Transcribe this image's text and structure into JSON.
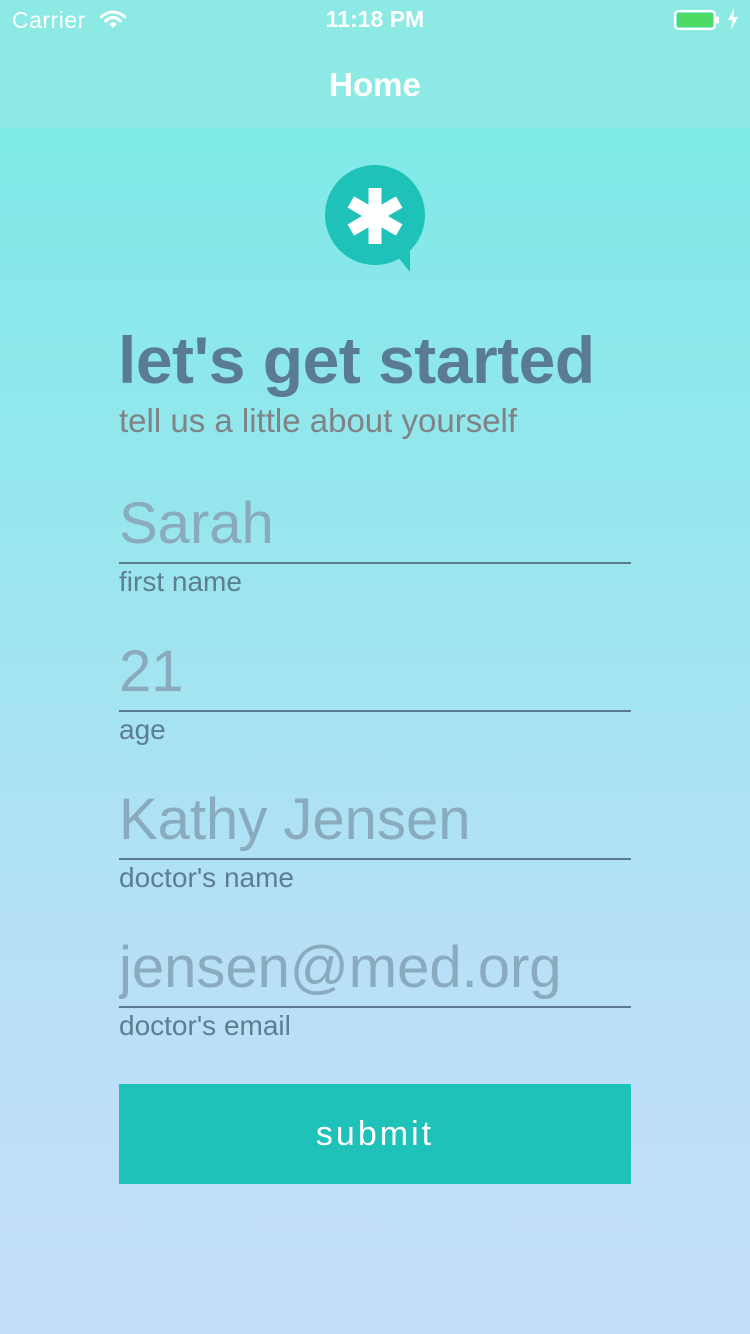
{
  "status_bar": {
    "carrier": "Carrier",
    "time": "11:18 PM",
    "wifi_icon": "wifi-icon",
    "battery_icon": "battery-icon",
    "charging_icon": "charging-bolt-icon",
    "battery_level": 1.0
  },
  "nav": {
    "title": "Home"
  },
  "logo": {
    "icon": "asterisk-chat-bubble-icon",
    "color": "#1fc2b8"
  },
  "header": {
    "title": "let's get started",
    "subtitle": "tell us a little about yourself"
  },
  "form": {
    "fields": [
      {
        "value": "Sarah",
        "label": "first name"
      },
      {
        "value": "21",
        "label": "age"
      },
      {
        "value": "Kathy Jensen",
        "label": "doctor's name"
      },
      {
        "value": "jensen@med.org",
        "label": "doctor's email"
      }
    ],
    "submit_label": "submit"
  },
  "colors": {
    "accent": "#1fc2b8",
    "heading": "#5a7b95",
    "subheading": "#7f8386",
    "field_text": "#8aaabe",
    "battery": "#4cd964"
  }
}
